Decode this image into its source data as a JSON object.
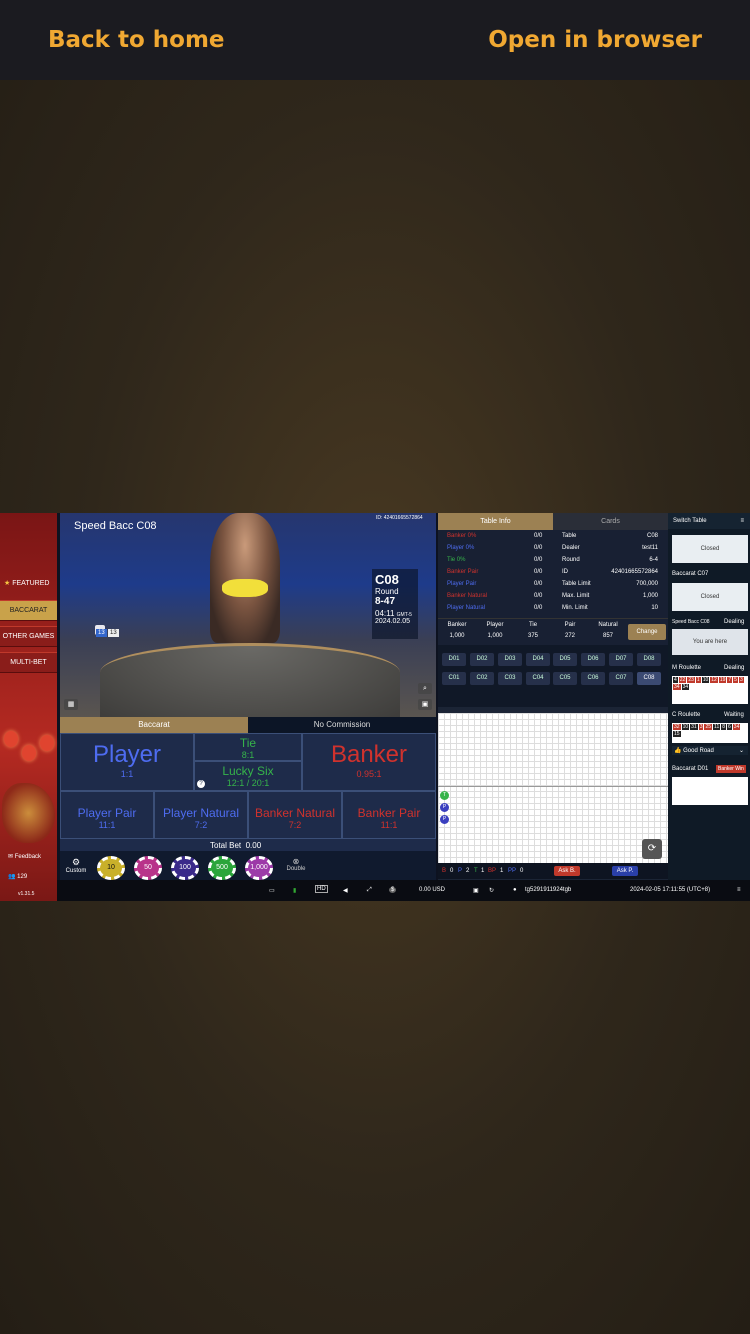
{
  "topbar": {
    "back_label": "Back to home",
    "open_label": "Open in browser"
  },
  "sidebar": {
    "featured": "FEATURED",
    "items": [
      "BACCARAT",
      "OTHER GAMES",
      "MULTI-BET"
    ],
    "feedback": "Feedback",
    "count": "129",
    "version": "v1.31.5"
  },
  "video": {
    "title": "Speed Bacc C08",
    "id": "ID: 42401665572864",
    "table_code": "C08",
    "round_label": "Round",
    "round_value": "8-47",
    "time": "04:11",
    "tz": "GMT-5",
    "date": "2024.02.05",
    "card_left": "13",
    "card_right": "13"
  },
  "bet": {
    "tab_baccarat": "Baccarat",
    "tab_nocommission": "No Commission",
    "player": "Player",
    "player_odd": "1:1",
    "tie": "Tie",
    "tie_odd": "8:1",
    "lucky_six": "Lucky Six",
    "lucky_odd": "12:1 / 20:1",
    "banker": "Banker",
    "banker_odd": "0.95:1",
    "player_pair": "Player Pair",
    "player_pair_odd": "11:1",
    "player_natural": "Player Natural",
    "player_natural_odd": "7:2",
    "banker_natural": "Banker Natural",
    "banker_natural_odd": "7:2",
    "banker_pair": "Banker Pair",
    "banker_pair_odd": "11:1",
    "total_bet_label": "Total Bet",
    "total_bet_value": "0.00",
    "custom_label": "Custom",
    "double_label": "Double"
  },
  "chips": [
    "10",
    "50",
    "100",
    "500",
    "1,000"
  ],
  "status": {
    "balance": "0.00 USD",
    "user": "tg5291911924tgb",
    "datetime": "2024-02-05   17:11:55 (UTC+8)",
    "hd": "HD"
  },
  "table_info": {
    "tab_info": "Table Info",
    "tab_cards": "Cards",
    "left_rows": [
      {
        "label": "Banker 0%",
        "value": "0/0",
        "color": "red"
      },
      {
        "label": "Player 0%",
        "value": "0/0",
        "color": "blue"
      },
      {
        "label": "Tie 0%",
        "value": "0/0",
        "color": "green"
      },
      {
        "label": "Banker Pair",
        "value": "0/0",
        "color": "red"
      },
      {
        "label": "Player Pair",
        "value": "0/0",
        "color": "blue"
      },
      {
        "label": "Banker Natural",
        "value": "0/0",
        "color": "red"
      },
      {
        "label": "Player Natural",
        "value": "0/0",
        "color": "blue"
      }
    ],
    "right_rows": [
      {
        "label": "Table",
        "value": "C08"
      },
      {
        "label": "Dealer",
        "value": "test11"
      },
      {
        "label": "Round",
        "value": "6-4"
      },
      {
        "label": "ID",
        "value": "42401665572864"
      },
      {
        "label": "Table Limit",
        "value": "700,000"
      },
      {
        "label": "Max. Limit",
        "value": "1,000"
      },
      {
        "label": "Min. Limit",
        "value": "10"
      }
    ],
    "limits": [
      {
        "label": "Banker",
        "value": "1,000"
      },
      {
        "label": "Player",
        "value": "1,000"
      },
      {
        "label": "Tie",
        "value": "375"
      },
      {
        "label": "Pair",
        "value": "272"
      },
      {
        "label": "Natural",
        "value": "857"
      }
    ],
    "change_label": "Change"
  },
  "tables_row1": [
    "D01",
    "D02",
    "D03",
    "D04",
    "D05",
    "D06",
    "D07",
    "D08"
  ],
  "tables_row2": [
    "C01",
    "C02",
    "C03",
    "C04",
    "C05",
    "C06",
    "C07",
    "C08"
  ],
  "road": {
    "counts": [
      {
        "label": "B",
        "value": "0",
        "color": "#d0322d"
      },
      {
        "label": "P",
        "value": "2",
        "color": "#4e6cf0"
      },
      {
        "label": "T",
        "value": "1",
        "color": "#36b34a"
      },
      {
        "label": "BP",
        "value": "1",
        "color": "#d0322d"
      },
      {
        "label": "PP",
        "value": "0",
        "color": "#4e6cf0"
      }
    ],
    "ask_banker": "Ask B.",
    "ask_player": "Ask P.",
    "beads": [
      "T",
      "P",
      "P"
    ]
  },
  "switch": {
    "title": "Switch Table",
    "closed": "Closed",
    "baccarat_c07": "Baccarat C07",
    "speed_c08": "Speed Bacc C08",
    "dealing": "Dealing",
    "you_are_here": "You are here",
    "m_roulette": "M Roulette",
    "c_roulette": "C Roulette",
    "waiting": "Waiting",
    "good_road": "Good Road",
    "baccarat_d01": "Baccarat D01",
    "banker_win": "Banker Win",
    "m_roulette_numbers": [
      "4",
      "22",
      "23",
      "1",
      "10",
      "12",
      "19",
      "7",
      "5",
      "3",
      "34",
      "34",
      "8",
      "32",
      "32",
      "1",
      "20",
      "10",
      "4",
      "12",
      "22"
    ],
    "c_roulette_numbers": [
      "32",
      "10",
      "31",
      "3",
      "25",
      "11",
      "8",
      "6",
      "34",
      "15",
      "32",
      "34",
      "1",
      "15",
      "33"
    ]
  }
}
